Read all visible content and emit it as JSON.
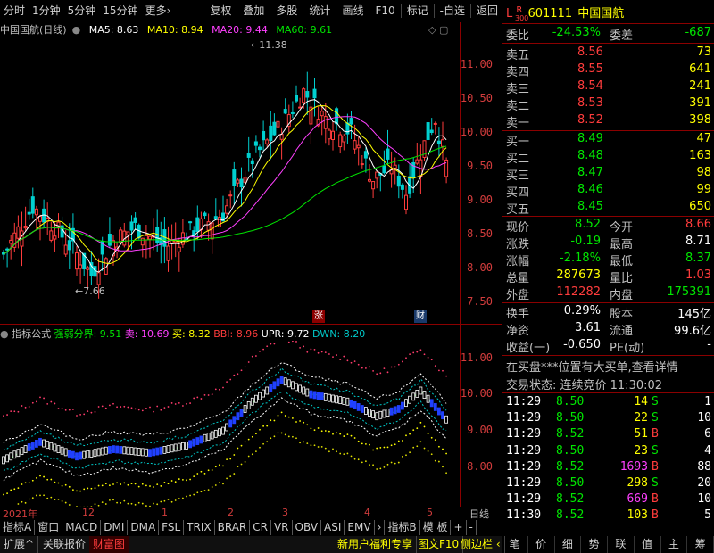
{
  "toolbar": {
    "left_items": [
      "分时",
      "1分钟",
      "5分钟",
      "15分钟",
      "更多›"
    ],
    "right_items": [
      "复权",
      "叠加",
      "多股",
      "统计",
      "画线",
      "F10",
      "标记",
      "-自选",
      "返回"
    ]
  },
  "stock": {
    "flag_l": "L",
    "flag_r": "R",
    "flag_num": "300",
    "code": "601111",
    "name": "中国国航"
  },
  "main_chart": {
    "title": "中国国航(日线)",
    "ma5": "MA5: 8.63",
    "ma10": "MA10: 8.94",
    "ma20": "MA20: 9.44",
    "ma60": "MA60: 9.61",
    "y_labels": [
      "11.00",
      "10.50",
      "10.00",
      "9.50",
      "9.00",
      "8.50",
      "8.00",
      "7.50"
    ],
    "high_note": "11.38",
    "low_note": "7.66",
    "event_zhang": "涨",
    "event_cai": "财"
  },
  "sub_chart": {
    "title": "指标公式",
    "name": "强弱分界: 9.51",
    "sell": "卖: 10.69",
    "buy": "买: 8.32",
    "bbi": "BBI: 8.96",
    "upr": "UPR: 9.72",
    "dwn": "DWN: 8.20",
    "y_labels": [
      "11.00",
      "10.00",
      "9.00",
      "8.00"
    ]
  },
  "time_axis": {
    "labels": [
      "2021年",
      "12",
      "1",
      "2",
      "3",
      "4",
      "5"
    ],
    "period": "日线"
  },
  "tabs_row1": [
    "指标A",
    "窗口",
    "MACD",
    "DMI",
    "DMA",
    "FSL",
    "TRIX",
    "BRAR",
    "CR",
    "VR",
    "OBV",
    "ASI",
    "EMV",
    "›",
    "指标B",
    "模",
    "板"
  ],
  "tabs_row2": {
    "expand": "扩展^",
    "related": "关联报价",
    "fin": "财富图",
    "promo": "新用户福利专享",
    "f10": "图文F10",
    "sidebar": "侧边栏 ‹"
  },
  "right_tabs": [
    "笔",
    "价",
    "细",
    "势",
    "联",
    "值",
    "主",
    "筹"
  ],
  "quote": {
    "wei_bi_label": "委比",
    "wei_bi": "-24.53%",
    "wei_cha_label": "委差",
    "wei_cha": "-687",
    "asks": [
      {
        "label": "卖五",
        "price": "8.56",
        "vol": "73"
      },
      {
        "label": "卖四",
        "price": "8.55",
        "vol": "641"
      },
      {
        "label": "卖三",
        "price": "8.54",
        "vol": "241"
      },
      {
        "label": "卖二",
        "price": "8.53",
        "vol": "391"
      },
      {
        "label": "卖一",
        "price": "8.52",
        "vol": "398"
      }
    ],
    "bids": [
      {
        "label": "买一",
        "price": "8.49",
        "vol": "47"
      },
      {
        "label": "买二",
        "price": "8.48",
        "vol": "163"
      },
      {
        "label": "买三",
        "price": "8.47",
        "vol": "98"
      },
      {
        "label": "买四",
        "price": "8.46",
        "vol": "99"
      },
      {
        "label": "买五",
        "price": "8.45",
        "vol": "650"
      }
    ],
    "stats": [
      {
        "l1": "现价",
        "v1": "8.52",
        "c1": "green",
        "l2": "今开",
        "v2": "8.66",
        "c2": "red"
      },
      {
        "l1": "涨跌",
        "v1": "-0.19",
        "c1": "green",
        "l2": "最高",
        "v2": "8.71",
        "c2": "white"
      },
      {
        "l1": "涨幅",
        "v1": "-2.18%",
        "c1": "green",
        "l2": "最低",
        "v2": "8.37",
        "c2": "green"
      },
      {
        "l1": "总量",
        "v1": "287673",
        "c1": "yellow",
        "l2": "量比",
        "v2": "1.03",
        "c2": "red"
      },
      {
        "l1": "外盘",
        "v1": "112282",
        "c1": "red",
        "l2": "内盘",
        "v2": "175391",
        "c2": "green"
      }
    ],
    "fund": [
      {
        "l1": "换手",
        "v1": "0.29%",
        "l2": "股本",
        "v2": "145亿"
      },
      {
        "l1": "净资",
        "v1": "3.61",
        "l2": "流通",
        "v2": "99.6亿"
      },
      {
        "l1": "收益(一)",
        "v1": "-0.650",
        "l2": "PE(动)",
        "v2": "-"
      }
    ],
    "notice": "在买盘***位置有大买单,查看详情",
    "status": "交易状态: 连续竞价 11:30:02"
  },
  "trades": [
    {
      "t": "11:29",
      "p": "8.50",
      "v": "14",
      "s": "S",
      "n": "1",
      "vc": "yellow",
      "sc": "green"
    },
    {
      "t": "11:29",
      "p": "8.50",
      "v": "22",
      "s": "S",
      "n": "10",
      "vc": "yellow",
      "sc": "green"
    },
    {
      "t": "11:29",
      "p": "8.52",
      "v": "51",
      "s": "B",
      "n": "6",
      "vc": "yellow",
      "sc": "red"
    },
    {
      "t": "11:29",
      "p": "8.50",
      "v": "23",
      "s": "S",
      "n": "4",
      "vc": "yellow",
      "sc": "green"
    },
    {
      "t": "11:29",
      "p": "8.52",
      "v": "1693",
      "s": "B",
      "n": "88",
      "vc": "magenta",
      "sc": "red"
    },
    {
      "t": "11:29",
      "p": "8.50",
      "v": "298",
      "s": "S",
      "n": "20",
      "vc": "yellow",
      "sc": "green"
    },
    {
      "t": "11:29",
      "p": "8.52",
      "v": "669",
      "s": "B",
      "n": "10",
      "vc": "magenta",
      "sc": "red"
    },
    {
      "t": "11:30",
      "p": "8.52",
      "v": "103",
      "s": "B",
      "n": "5",
      "vc": "yellow",
      "sc": "red"
    }
  ]
}
